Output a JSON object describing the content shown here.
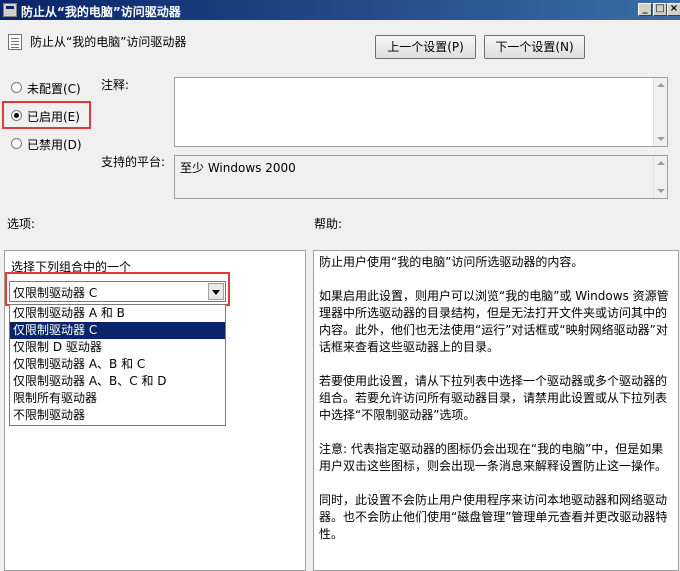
{
  "window": {
    "title": "防止从“我的电脑”访问驱动器",
    "controls": [
      "minimize",
      "maximize",
      "close"
    ]
  },
  "header": {
    "title": "防止从“我的电脑”访问驱动器",
    "prev_button": "上一个设置(P)",
    "next_button": "下一个设置(N)"
  },
  "radios": [
    {
      "label": "未配置(C)",
      "checked": false
    },
    {
      "label": "已启用(E)",
      "checked": true
    },
    {
      "label": "已禁用(D)",
      "checked": false
    }
  ],
  "comment": {
    "label": "注释:",
    "value": ""
  },
  "platform": {
    "label": "支持的平台:",
    "value": "至少 Windows 2000"
  },
  "options": {
    "section_label": "选项:",
    "prompt": "选择下列组合中的一个",
    "selected": "仅限制驱动器 C",
    "list": [
      "仅限制驱动器 A 和 B",
      "仅限制驱动器 C",
      "仅限制 D 驱动器",
      "仅限制驱动器 A、B 和 C",
      "仅限制驱动器 A、B、C 和 D",
      "限制所有驱动器",
      "不限制驱动器"
    ],
    "highlighted_index": 1
  },
  "help": {
    "section_label": "帮助:",
    "paragraphs": [
      "防止用户使用“我的电脑”访问所选驱动器的内容。",
      "如果启用此设置，则用户可以浏览“我的电脑”或 Windows 资源管理器中所选驱动器的目录结构，但是无法打开文件夹或访问其中的内容。此外，他们也无法使用“运行”对话框或“映射网络驱动器”对话框来查看这些驱动器上的目录。",
      "若要使用此设置，请从下拉列表中选择一个驱动器或多个驱动器的组合。若要允许访问所有驱动器目录，请禁用此设置或从下拉列表中选择“不限制驱动器”选项。",
      "注意: 代表指定驱动器的图标仍会出现在“我的电脑”中，但是如果用户双击这些图标，则会出现一条消息来解释设置防止这一操作。",
      "同时，此设置不会防止用户使用程序来访问本地驱动器和网络驱动器。也不会防止他们使用“磁盘管理”管理单元查看并更改驱动器特性。"
    ]
  },
  "colors": {
    "highlight": "#0a246a",
    "annotation_red": "#e03a3a"
  }
}
